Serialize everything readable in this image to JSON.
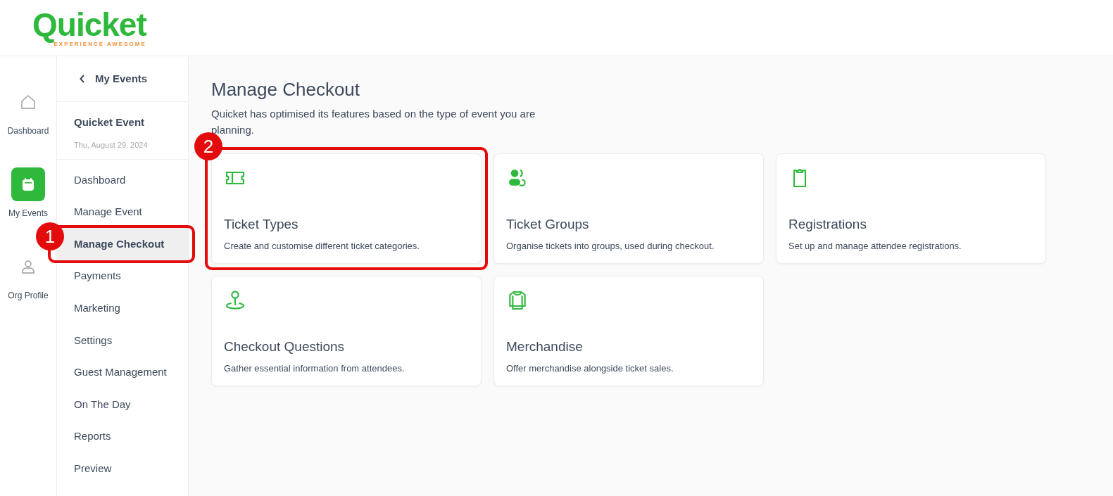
{
  "logo": {
    "name": "Quicket",
    "tagline": "EXPERIENCE AWESOME"
  },
  "rail": [
    {
      "label": "Dashboard",
      "selected": false
    },
    {
      "label": "My Events",
      "selected": true
    },
    {
      "label": "Org Profile",
      "selected": false
    }
  ],
  "submenu": {
    "back": "My Events",
    "event_name": "Quicket Event",
    "event_date": "Thu, August 29, 2024",
    "items": [
      {
        "label": "Dashboard",
        "selected": false
      },
      {
        "label": "Manage Event",
        "selected": false
      },
      {
        "label": "Manage Checkout",
        "selected": true,
        "callout": "1"
      },
      {
        "label": "Payments",
        "selected": false
      },
      {
        "label": "Marketing",
        "selected": false
      },
      {
        "label": "Settings",
        "selected": false
      },
      {
        "label": "Guest Management",
        "selected": false
      },
      {
        "label": "On The Day",
        "selected": false
      },
      {
        "label": "Reports",
        "selected": false
      },
      {
        "label": "Preview",
        "selected": false
      }
    ]
  },
  "page": {
    "title": "Manage Checkout",
    "intro": "Quicket has optimised its features based on the type of event you are planning."
  },
  "cards": [
    {
      "title": "Ticket Types",
      "description": "Create and customise different ticket categories.",
      "callout": "2"
    },
    {
      "title": "Ticket Groups",
      "description": "Organise tickets into groups, used during checkout."
    },
    {
      "title": "Registrations",
      "description": "Set up and manage attendee registrations."
    },
    {
      "title": "Checkout Questions",
      "description": "Gather essential information from attendees."
    },
    {
      "title": "Merchandise",
      "description": "Offer merchandise alongside ticket sales."
    }
  ]
}
